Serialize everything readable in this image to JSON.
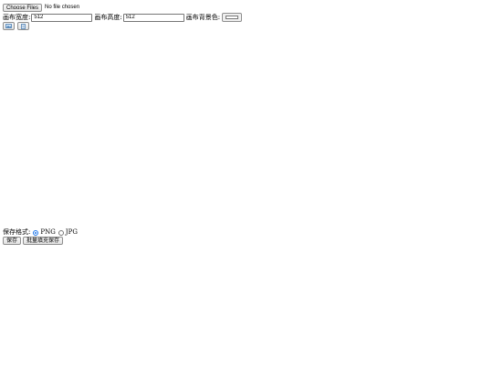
{
  "file_input": {
    "button_label": "Choose Files",
    "status_text": "No file chosen"
  },
  "canvas_settings": {
    "width_label": "画布宽度:",
    "width_value": "512",
    "height_label": "画布高度:",
    "height_value": "512",
    "bg_color_label": "画布背景色:",
    "bg_color": "#ffffff"
  },
  "icon_buttons": [
    {
      "icon": "image-icon"
    },
    {
      "icon": "document-icon"
    }
  ],
  "save_format": {
    "label": "保存格式:",
    "options": [
      {
        "label": "PNG",
        "checked": true
      },
      {
        "label": "JPG",
        "checked": false
      }
    ]
  },
  "actions": {
    "save_label": "保存",
    "batch_save_label": "批量填充保存"
  },
  "colors": {
    "accent": "#1a73e8"
  }
}
